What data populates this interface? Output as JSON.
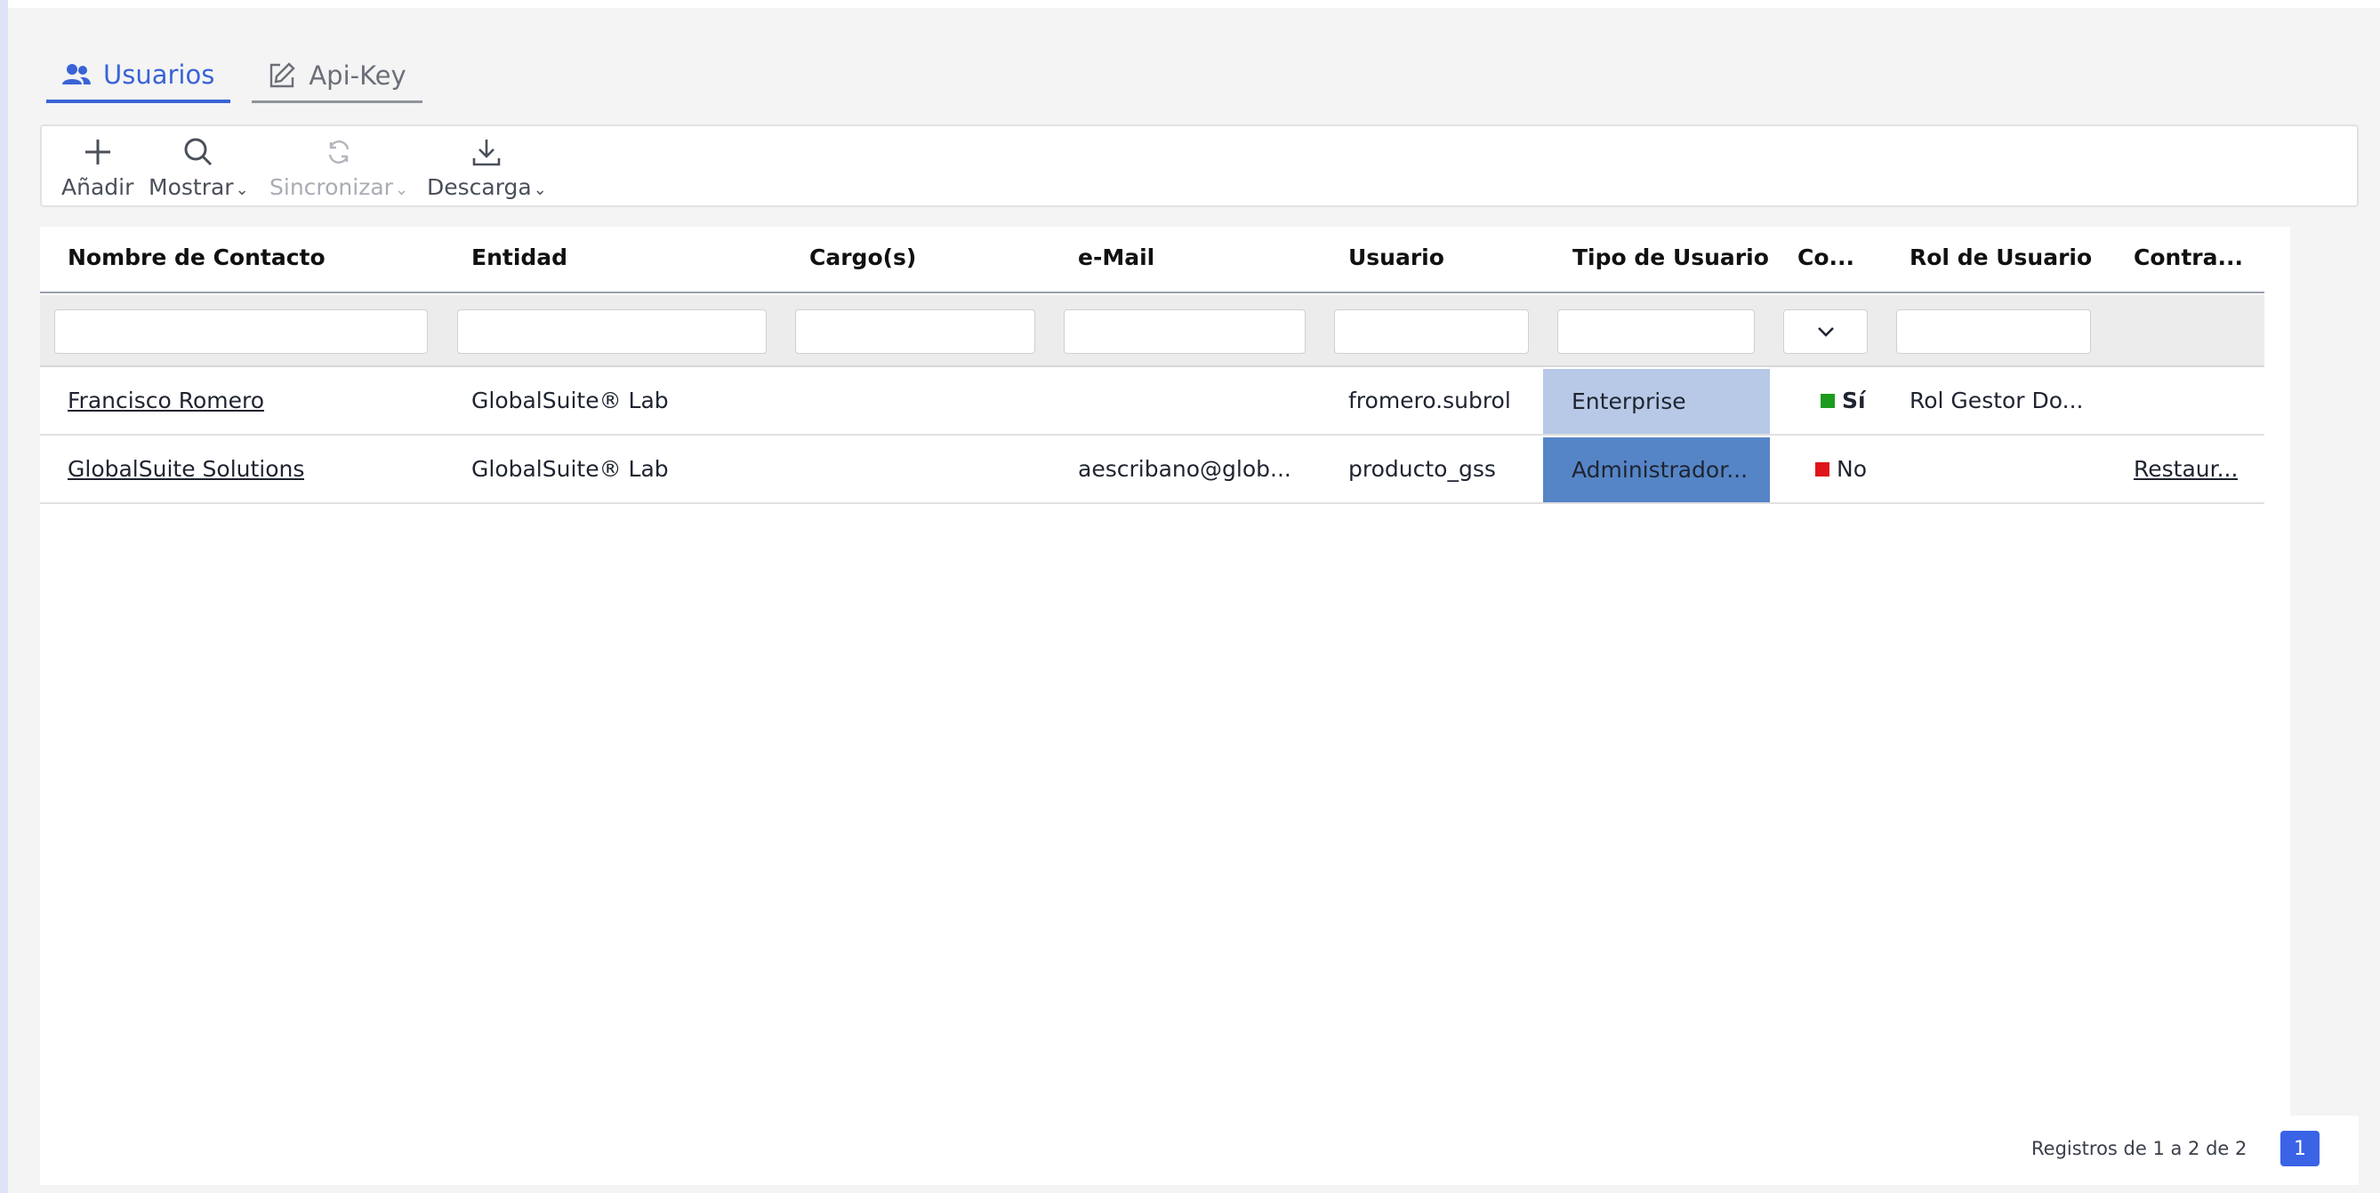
{
  "tabs": [
    {
      "label": "Usuarios",
      "icon": "users-icon",
      "active": true
    },
    {
      "label": "Api-Key",
      "icon": "edit-icon",
      "active": false
    }
  ],
  "toolbar": {
    "add_label": "Añadir",
    "show_label": "Mostrar",
    "sync_label": "Sincronizar",
    "download_label": "Descarga"
  },
  "table": {
    "columns": [
      "Nombre de Contacto",
      "Entidad",
      "Cargo(s)",
      "e-Mail",
      "Usuario",
      "Tipo de Usuario",
      "Co...",
      "Rol de Usuario",
      "Contra..."
    ],
    "rows": [
      {
        "nombre": "Francisco Romero",
        "entidad": "GlobalSuite® Lab",
        "cargo": "",
        "email": "",
        "usuario": "fromero.subrol",
        "tipo": "Enterprise",
        "tipo_color": "#b7c9e6",
        "co": "Sí",
        "co_color": "#1e9b1e",
        "rol": "Rol Gestor Do...",
        "contra": ""
      },
      {
        "nombre": "GlobalSuite Solutions",
        "entidad": "GlobalSuite® Lab",
        "cargo": "",
        "email": "aescribano@glob...",
        "usuario": "producto_gss",
        "tipo": "Administrador...",
        "tipo_color": "#5585c7",
        "co": "No",
        "co_color": "#e0141b",
        "rol": "",
        "contra": "Restaur..."
      }
    ]
  },
  "pagination": {
    "summary": "Registros de 1 a 2 de 2",
    "current_page": "1"
  },
  "colors": {
    "accent": "#3a63d6",
    "page_bg": "#f4f4f4"
  }
}
